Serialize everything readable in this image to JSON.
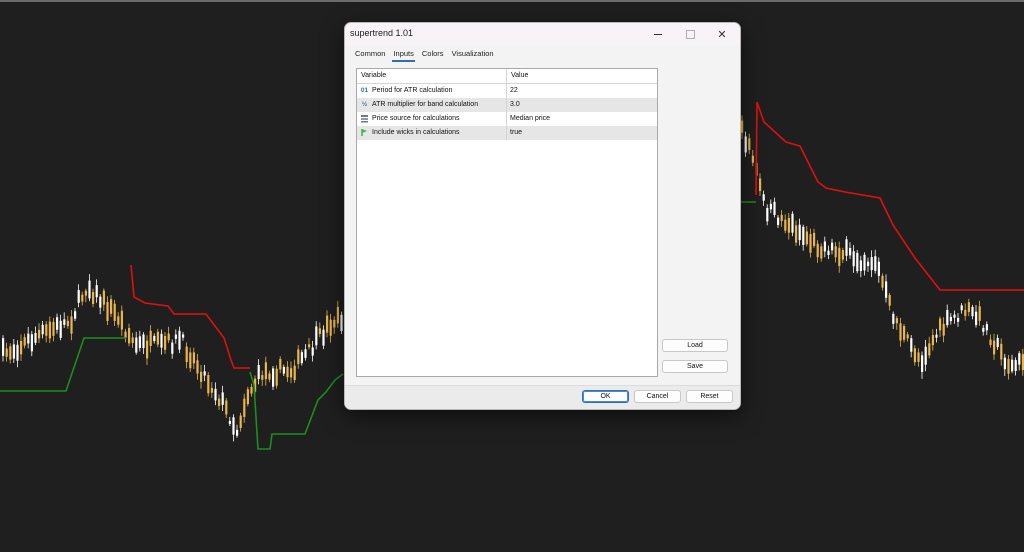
{
  "dialog": {
    "title": "supertrend 1.01",
    "window_controls": {
      "minimize_icon": "minimize-icon",
      "maximize_icon": "maximize-icon",
      "close_icon": "close-icon"
    },
    "tabs": [
      {
        "label": "Common",
        "active": false
      },
      {
        "label": "Inputs",
        "active": true
      },
      {
        "label": "Colors",
        "active": false
      },
      {
        "label": "Visualization",
        "active": false
      }
    ],
    "grid": {
      "columns": [
        "Variable",
        "Value"
      ],
      "rows": [
        {
          "icon": "int-type-icon",
          "variable": "Period for ATR calculation",
          "value": "22"
        },
        {
          "icon": "double-type-icon",
          "variable": "ATR multiplier for band calculation",
          "value": "3.0"
        },
        {
          "icon": "enum-type-icon",
          "variable": "Price source for calculations",
          "value": "Median price"
        },
        {
          "icon": "bool-type-icon",
          "variable": "Include wicks in calculations",
          "value": "true"
        }
      ]
    },
    "side_buttons": {
      "load": "Load",
      "save": "Save"
    },
    "footer_buttons": {
      "ok": "OK",
      "cancel": "Cancel",
      "reset": "Reset"
    }
  },
  "chart": {
    "background": "#1f1f1f",
    "colors": {
      "bull_candle": "#e8b64a",
      "bear_candle": "#ffffff",
      "supertrend_up": "#1a8f1a",
      "supertrend_down": "#e01010"
    }
  }
}
